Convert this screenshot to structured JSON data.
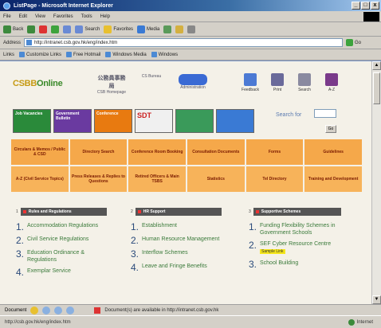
{
  "window": {
    "title": "ListPage - Microsoft Internet Explorer"
  },
  "menu": [
    "File",
    "Edit",
    "View",
    "Favorites",
    "Tools",
    "Help"
  ],
  "toolbar": [
    {
      "label": "Back",
      "icon": "back-icon",
      "color": "#3d8a3d"
    },
    {
      "label": "",
      "icon": "forward-icon",
      "color": "#3d8a3d"
    },
    {
      "label": "",
      "icon": "stop-icon",
      "color": "#d33"
    },
    {
      "label": "",
      "icon": "refresh-icon",
      "color": "#3da33d"
    },
    {
      "label": "",
      "icon": "home-icon",
      "color": "#6a8ad4"
    },
    {
      "label": "Search",
      "icon": "search-icon",
      "color": "#6a8ad4"
    },
    {
      "label": "Favorites",
      "icon": "favorites-icon",
      "color": "#e8c030"
    },
    {
      "label": "Media",
      "icon": "media-icon",
      "color": "#3a7ad4"
    },
    {
      "label": "",
      "icon": "history-icon",
      "color": "#5a9a5a"
    },
    {
      "label": "",
      "icon": "mail-icon",
      "color": "#d4b040"
    },
    {
      "label": "",
      "icon": "print-icon",
      "color": "#888"
    }
  ],
  "address": {
    "label": "Address",
    "value": "http://intranet.csb.gov.hk/eng/index.htm",
    "go": "Go"
  },
  "links": {
    "label": "Links",
    "items": [
      "Customize Links",
      "Free Hotmail",
      "Windows Media",
      "Windows"
    ]
  },
  "site": {
    "logo_main": "CSBB",
    "logo_accent": "Online",
    "tags": [
      {
        "main": "公務員事務局",
        "sub": "CSB Homepage"
      },
      {
        "main": "",
        "sub": "CS Bureau"
      },
      {
        "main": "",
        "sub": "Administration"
      }
    ],
    "tools": [
      {
        "label": "Feedback",
        "icon": "feedback-icon",
        "color": "#4c7ad4"
      },
      {
        "label": "Print",
        "icon": "print-icon",
        "color": "#6a6a9a"
      },
      {
        "label": "Search",
        "icon": "search-icon",
        "color": "#8a8aa0"
      },
      {
        "label": "A-Z",
        "icon": "az-index-icon",
        "color": "#7a3a8a"
      }
    ],
    "banners": [
      {
        "text": "Job Vacancies",
        "color": "#2a8a3a"
      },
      {
        "text": "Government Bulletin",
        "color": "#6a3aa0"
      },
      {
        "text": "Conference",
        "color": "#e87a10"
      },
      {
        "text": "SDT",
        "color": "#f0f0f0"
      },
      {
        "text": "",
        "color": "#3a9a5a"
      },
      {
        "text": "",
        "color": "#3a7ad4"
      }
    ],
    "search_label": "Search for",
    "search_button": "Go"
  },
  "nav": [
    "Circulars & Memos / Public & CSD",
    "Directory Search",
    "Conference Room Booking",
    "Consultation Documents",
    "Forms",
    "Guidelines",
    "A-Z (Civil Service Topics)",
    "Press Releases & Replies to Questions",
    "Retired Officers & Main TSBS",
    "Statistics",
    "Tel Directory",
    "Training and Development"
  ],
  "columns": [
    {
      "num": "1",
      "title": "Rules and Regulations",
      "items": [
        "Accommodation Regulations",
        "Civil Service Regulations",
        "Education Ordinance & Regulations",
        "Exemplar Service"
      ]
    },
    {
      "num": "2",
      "title": "HR Support",
      "items": [
        "Establishment",
        "Human Resource Management",
        "Interflow Schemes",
        "Leave and Fringe Benefits"
      ]
    },
    {
      "num": "3",
      "title": "Supportive Schemes",
      "items": [
        "Funding Flexibility Schemes in Government Schools",
        "SEF Cyber Resource Centre",
        "School Building"
      ],
      "badge": "Sample Link"
    }
  ],
  "status": {
    "task_label": "Document",
    "message": "Document(s) are available in http://intranet.csb.gov.hk",
    "bottom": "http://csb.gov.hk/eng/index.htm",
    "zone": "Internet"
  }
}
